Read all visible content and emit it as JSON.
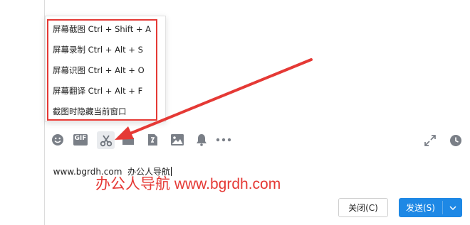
{
  "menu": {
    "items": [
      {
        "label": "屏幕截图 Ctrl + Shift + A"
      },
      {
        "label": "屏幕录制 Ctrl + Alt + S"
      },
      {
        "label": "屏幕识图 Ctrl + Alt + O"
      },
      {
        "label": "屏幕翻译 Ctrl + Alt + F"
      },
      {
        "label": "截图时隐藏当前窗口"
      }
    ]
  },
  "toolbar": {
    "icons": [
      "emoji-icon",
      "gif-icon",
      "scissors-icon",
      "folder-icon",
      "file-icon",
      "image-icon",
      "bell-icon",
      "more-icon",
      "expand-icon",
      "history-icon"
    ],
    "gif_label": "GIF"
  },
  "message": {
    "text": "www.bgrdh.com  办公人导航"
  },
  "watermark": {
    "text": "办公人导航 www.bgrdh.com"
  },
  "buttons": {
    "close_label": "关闭(C)",
    "send_label": "发送(S)"
  },
  "colors": {
    "highlight": "#e53935",
    "send_button": "#1e88e5",
    "icon": "#7a7f87"
  }
}
